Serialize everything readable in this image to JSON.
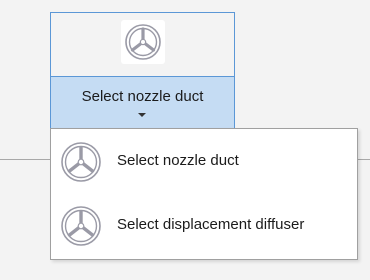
{
  "ribbon_button": {
    "label": "Select nozzle duct",
    "icon": "duct-fan-icon"
  },
  "dropdown_menu": {
    "items": [
      {
        "label": "Select nozzle duct",
        "icon": "nozzle-duct-icon"
      },
      {
        "label": "Select displacement diffuser",
        "icon": "displacement-diffuser-icon"
      }
    ]
  },
  "colors": {
    "background": "#f3f3f3",
    "button_border": "#5b97d6",
    "button_dropdown_bg": "#c5dcf3",
    "menu_bg": "#ffffff",
    "menu_border": "#a0a0a0",
    "icon_stroke": "#9a9aa6",
    "text": "#1b1b1b"
  }
}
